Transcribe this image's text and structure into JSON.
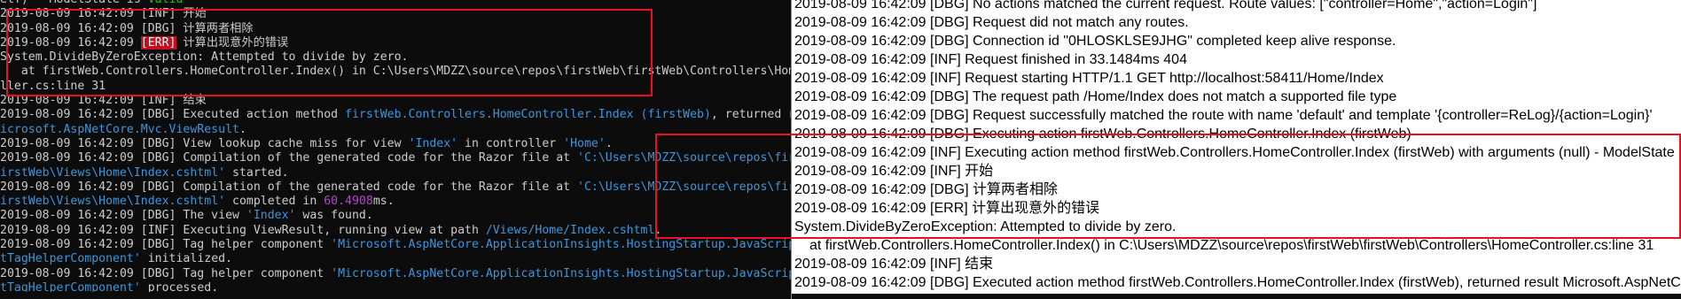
{
  "console": {
    "lines": [
      {
        "parts": [
          {
            "t": "elf) - ModelState is ",
            "c": ""
          },
          {
            "t": "Valid",
            "c": "green"
          }
        ]
      },
      {
        "parts": [
          {
            "t": "2019-08-09 16:42:09 [INF] 开始",
            "c": ""
          }
        ]
      },
      {
        "parts": [
          {
            "t": "2019-08-09 16:42:09 [DBG] 计算两者相除",
            "c": ""
          }
        ]
      },
      {
        "parts": [
          {
            "t": "2019-08-09 16:42:09 ",
            "c": ""
          },
          {
            "t": "[ERR]",
            "c": "err"
          },
          {
            "t": " 计算出现意外的错误",
            "c": ""
          }
        ]
      },
      {
        "parts": [
          {
            "t": "System.DivideByZeroException: Attempted to divide by zero.",
            "c": ""
          }
        ]
      },
      {
        "parts": [
          {
            "t": "   at firstWeb.Controllers.HomeController.Index() in C:\\Users\\MDZZ\\source\\repos\\firstWeb\\firstWeb\\Controllers\\HomeContro",
            "c": ""
          }
        ]
      },
      {
        "parts": [
          {
            "t": "ller.cs:line 31",
            "c": ""
          }
        ]
      },
      {
        "parts": [
          {
            "t": "2019-08-09 16:42:09 [INF] 结束",
            "c": ""
          }
        ]
      },
      {
        "parts": [
          {
            "t": "2019-08-09 16:42:09 [DBG] Executed action method ",
            "c": ""
          },
          {
            "t": "firstWeb.Controllers.HomeController.Index (firstWeb)",
            "c": "cyan"
          },
          {
            "t": ", returned result M",
            "c": ""
          }
        ]
      },
      {
        "parts": [
          {
            "t": "icrosoft.AspNetCore.Mvc.ViewResult",
            "c": "cyan"
          },
          {
            "t": ".",
            "c": ""
          }
        ]
      },
      {
        "parts": [
          {
            "t": "2019-08-09 16:42:09 [DBG] View lookup cache miss for view ",
            "c": ""
          },
          {
            "t": "'Index'",
            "c": "cyan"
          },
          {
            "t": " in controller ",
            "c": ""
          },
          {
            "t": "'Home'",
            "c": "cyan"
          },
          {
            "t": ".",
            "c": ""
          }
        ]
      },
      {
        "parts": [
          {
            "t": "2019-08-09 16:42:09 [DBG] Compilation of the generated code for the Razor file at ",
            "c": ""
          },
          {
            "t": "'C:\\Users\\MDZZ\\source\\repos\\firstWeb\\f",
            "c": "cyan"
          }
        ]
      },
      {
        "parts": [
          {
            "t": "irstWeb\\Views\\Home\\Index.cshtml'",
            "c": "cyan"
          },
          {
            "t": " started.",
            "c": ""
          }
        ]
      },
      {
        "parts": [
          {
            "t": "2019-08-09 16:42:09 [DBG] Compilation of the generated code for the Razor file at ",
            "c": ""
          },
          {
            "t": "'C:\\Users\\MDZZ\\source\\repos\\firstWeb\\f",
            "c": "cyan"
          }
        ]
      },
      {
        "parts": [
          {
            "t": "irstWeb\\Views\\Home\\Index.cshtml'",
            "c": "cyan"
          },
          {
            "t": " completed in ",
            "c": ""
          },
          {
            "t": "60.4908",
            "c": "magenta"
          },
          {
            "t": "ms.",
            "c": ""
          }
        ]
      },
      {
        "parts": [
          {
            "t": "2019-08-09 16:42:09 [DBG] The view ",
            "c": ""
          },
          {
            "t": "'Index'",
            "c": "cyan"
          },
          {
            "t": " was found.",
            "c": ""
          }
        ]
      },
      {
        "parts": [
          {
            "t": "2019-08-09 16:42:09 [INF] Executing ViewResult, running view at path ",
            "c": ""
          },
          {
            "t": "/Views/Home/Index.cshtml",
            "c": "cyan"
          },
          {
            "t": ".",
            "c": ""
          }
        ]
      },
      {
        "parts": [
          {
            "t": "2019-08-09 16:42:09 [DBG] Tag helper component ",
            "c": ""
          },
          {
            "t": "'Microsoft.AspNetCore.ApplicationInsights.HostingStartup.JavaScriptSnippe",
            "c": "cyan"
          }
        ]
      },
      {
        "parts": [
          {
            "t": "tTagHelperComponent'",
            "c": "cyan"
          },
          {
            "t": " initialized.",
            "c": ""
          }
        ]
      },
      {
        "parts": [
          {
            "t": "2019-08-09 16:42:09 [DBG] Tag helper component ",
            "c": ""
          },
          {
            "t": "'Microsoft.AspNetCore.ApplicationInsights.HostingStartup.JavaScriptSnippe",
            "c": "cyan"
          }
        ]
      },
      {
        "parts": [
          {
            "t": "tTagHelperComponent'",
            "c": "cyan"
          },
          {
            "t": " processed.",
            "c": ""
          }
        ]
      }
    ]
  },
  "logfile": {
    "lines": [
      {
        "t": "2019-08-09 16:42:09 [DBG] No actions matched the current request. Route values: [\"controller=Home\",\"action=Login\"]",
        "indent": false
      },
      {
        "t": "2019-08-09 16:42:09 [DBG] Request did not match any routes.",
        "indent": false
      },
      {
        "t": "2019-08-09 16:42:09 [DBG] Connection id \"0HLOSKLSE9JHG\" completed keep alive response.",
        "indent": false
      },
      {
        "t": "2019-08-09 16:42:09 [INF] Request finished in 33.1484ms 404",
        "indent": false
      },
      {
        "t": "2019-08-09 16:42:09 [INF] Request starting HTTP/1.1 GET http://localhost:58411/Home/Index",
        "indent": false
      },
      {
        "t": "2019-08-09 16:42:09 [DBG] The request path /Home/Index does not match a supported file type",
        "indent": false
      },
      {
        "t": "2019-08-09 16:42:09 [DBG] Request successfully matched the route with name 'default' and template '{controller=ReLog}/{action=Login}'",
        "indent": false
      },
      {
        "t": "2019-08-09 16:42:09 [DBG] Executing action firstWeb.Controllers.HomeController.Index (firstWeb)",
        "indent": false
      },
      {
        "t": "2019-08-09 16:42:09 [INF] Executing action method firstWeb.Controllers.HomeController.Index (firstWeb) with arguments (null) - ModelState is Valid",
        "indent": false
      },
      {
        "t": "2019-08-09 16:42:09 [INF] 开始",
        "indent": false
      },
      {
        "t": "2019-08-09 16:42:09 [DBG] 计算两者相除",
        "indent": false
      },
      {
        "t": "2019-08-09 16:42:09 [ERR] 计算出现意外的错误",
        "indent": false
      },
      {
        "t": "System.DivideByZeroException: Attempted to divide by zero.",
        "indent": false
      },
      {
        "t": "at firstWeb.Controllers.HomeController.Index() in C:\\Users\\MDZZ\\source\\repos\\firstWeb\\firstWeb\\Controllers\\HomeController.cs:line 31",
        "indent": true
      },
      {
        "t": "2019-08-09 16:42:09 [INF] 结束",
        "indent": false
      },
      {
        "t": "2019-08-09 16:42:09 [DBG] Executed action method firstWeb.Controllers.HomeController.Index (firstWeb), returned result Microsoft.AspNetCore.Mvc.ViewResult.",
        "indent": false
      },
      {
        "t": "2019-08-09 16:42:09 [DBG] View lookup cache miss for view 'Index' in controller 'Home'.",
        "indent": false
      }
    ]
  },
  "colors": {
    "console_bg": "#0c0c0c",
    "console_text": "#cccccc",
    "highlight_border": "#e81123",
    "error_badge_bg": "#c50f1f",
    "path_text": "#3a96dd",
    "valid_text": "#16c60c",
    "number_text": "#b148c6"
  }
}
